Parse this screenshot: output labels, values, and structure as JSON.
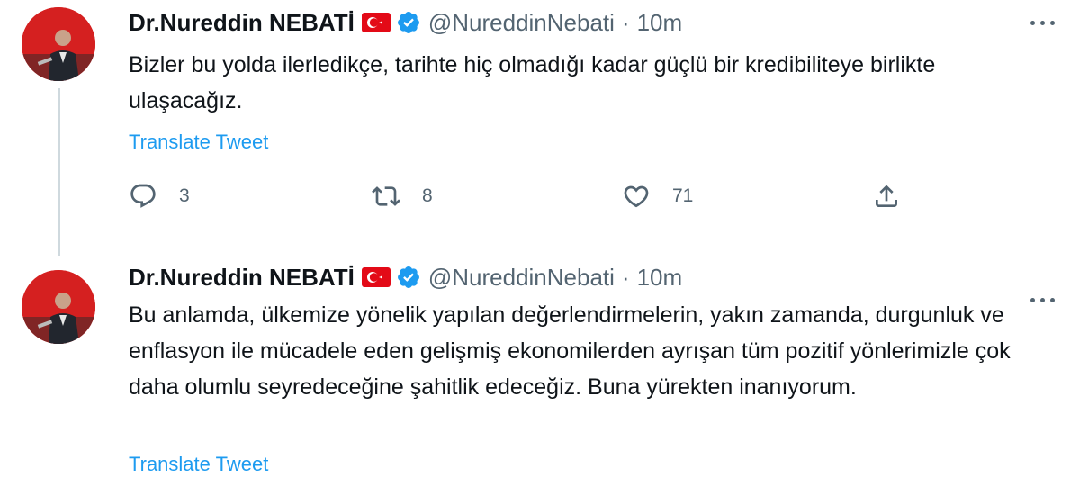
{
  "tweets": [
    {
      "author_name": "Dr.Nureddin NEBATİ",
      "handle": "@NureddinNebati",
      "separator": "·",
      "time": "10m",
      "text": "Bizler bu yolda ilerledikçe, tarihte hiç olmadığı kadar güçlü bir kredibiliteye birlikte ulaşacağız.",
      "translate_label": "Translate Tweet",
      "reply_count": "3",
      "retweet_count": "8",
      "like_count": "71"
    },
    {
      "author_name": "Dr.Nureddin NEBATİ",
      "handle": "@NureddinNebati",
      "separator": "·",
      "time": "10m",
      "text": "Bu anlamda, ülkemize yönelik yapılan değerlendirmelerin, yakın zamanda, durgunluk ve enflasyon ile mücadele eden gelişmiş ekonomilerden ayrışan tüm pozitif yönlerimizle çok daha olumlu seyredeceğine şahitlik edeceğiz. Buna yürekten inanıyorum.",
      "translate_label": "Translate Tweet"
    }
  ],
  "icons": {
    "flag": "turkey-flag-icon",
    "verified": "verified-badge-icon",
    "more": "more-options-icon",
    "reply": "reply-icon",
    "retweet": "retweet-icon",
    "like": "like-heart-icon",
    "share": "share-icon"
  },
  "colors": {
    "link": "#1d9bf0",
    "secondary_text": "#536471",
    "primary_text": "#0f1419",
    "verified": "#1d9bf0",
    "flag_red": "#e30a17",
    "thread_line": "#cfd9de"
  }
}
